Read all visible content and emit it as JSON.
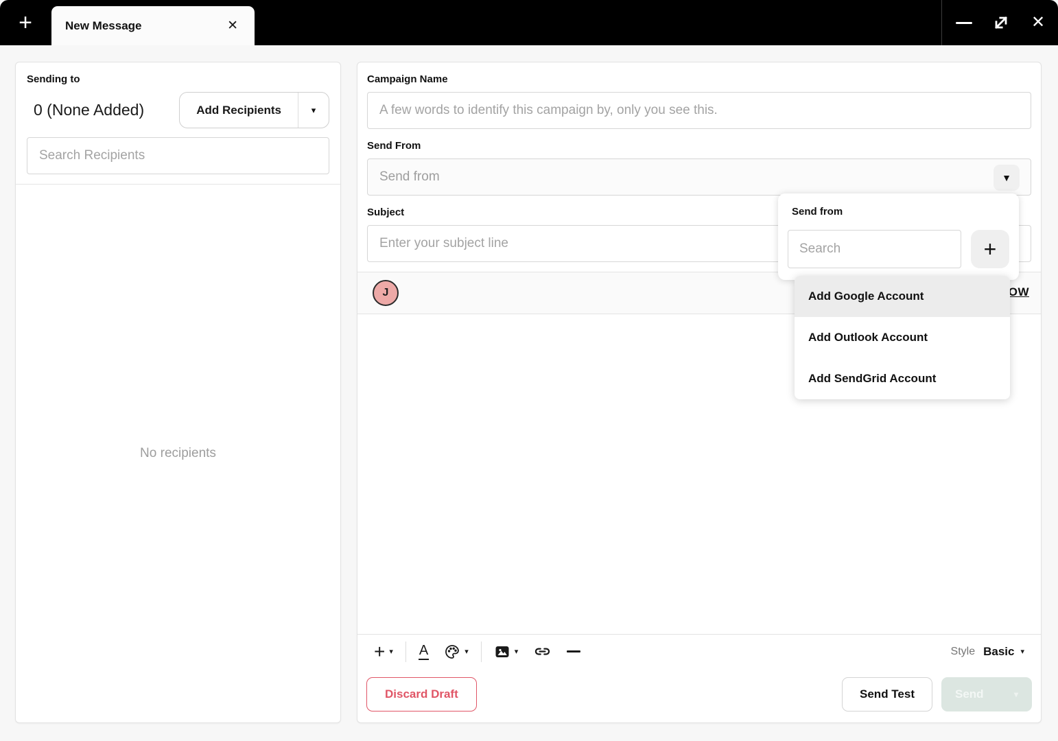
{
  "window": {
    "tab_title": "New Message"
  },
  "recipients_panel": {
    "label": "Sending to",
    "count_text": "0 (None Added)",
    "add_button_label": "Add Recipients",
    "search_placeholder": "Search Recipients",
    "empty_text": "No recipients"
  },
  "compose": {
    "campaign_name_label": "Campaign Name",
    "campaign_name_placeholder": "A few words to identify this campaign by, only you see this.",
    "send_from_label": "Send From",
    "send_from_placeholder": "Send from",
    "subject_label": "Subject",
    "subject_placeholder": "Enter your subject line",
    "avatar_initial": "J",
    "partial_link_text": "OW",
    "style_label": "Style",
    "style_value": "Basic",
    "discard_button": "Discard Draft",
    "send_test_button": "Send Test",
    "send_button": "Send"
  },
  "send_from_popup": {
    "title": "Send from",
    "search_placeholder": "Search",
    "items": [
      {
        "label": "Add Google Account",
        "highlighted": true
      },
      {
        "label": "Add Outlook Account",
        "highlighted": false
      },
      {
        "label": "Add SendGrid Account",
        "highlighted": false
      }
    ]
  },
  "colors": {
    "topbar": "#000000",
    "page_background": "#f7f7f7",
    "discard_red": "#e05566",
    "send_disabled_background": "#dce6e1",
    "avatar_pink": "#eda9a7",
    "menu_highlight": "#ececec"
  }
}
